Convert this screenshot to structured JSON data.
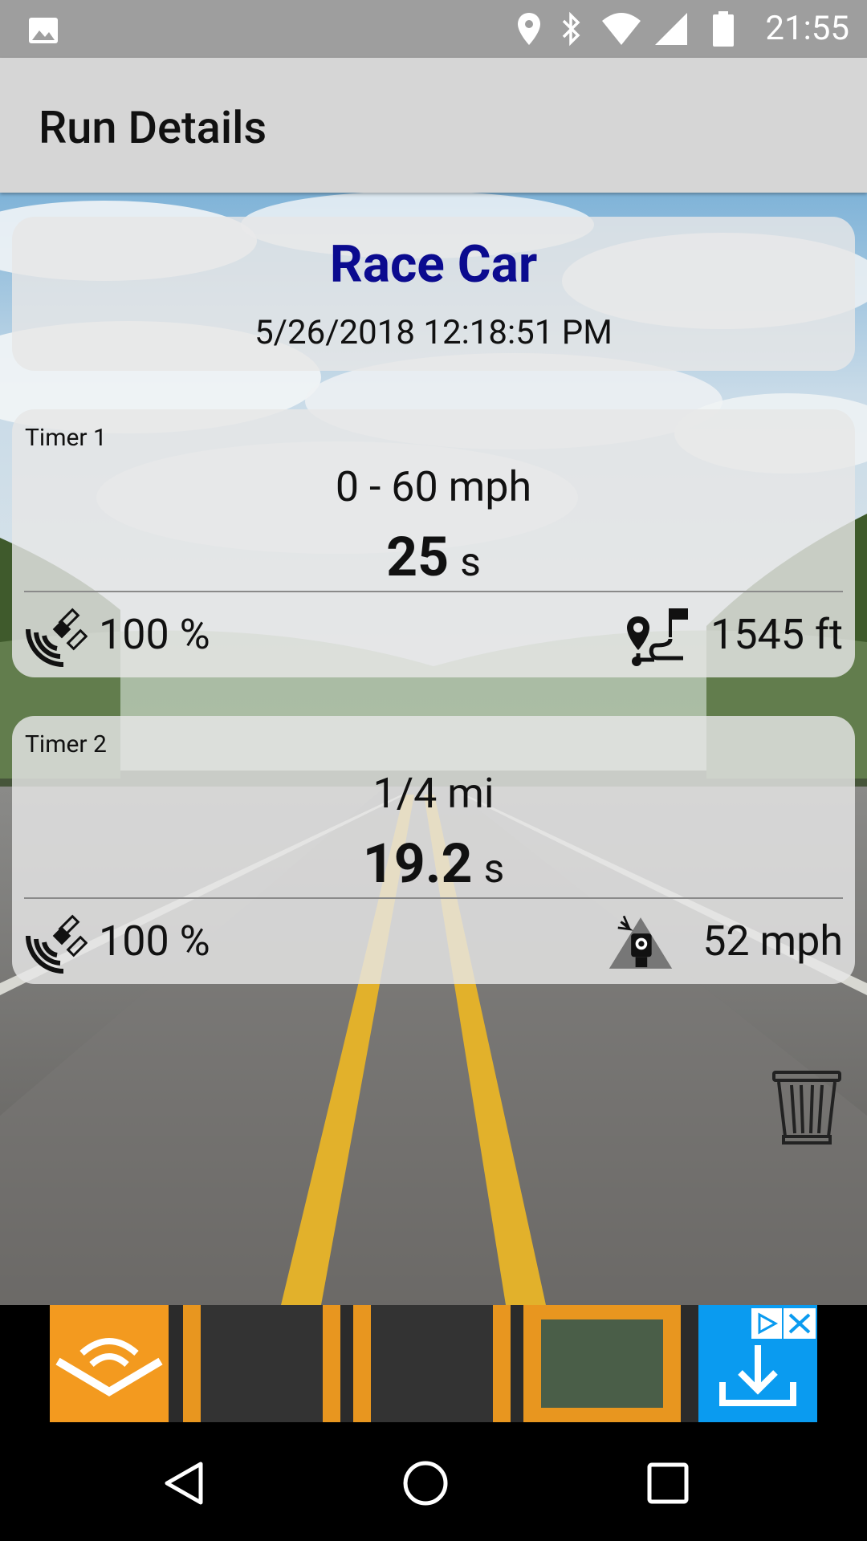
{
  "status_bar": {
    "time": "21:55",
    "icons": [
      "image-icon",
      "location-icon",
      "bluetooth-icon",
      "wifi-icon",
      "signal-icon",
      "battery-icon"
    ]
  },
  "app_bar": {
    "title": "Run Details"
  },
  "run": {
    "name": "Race Car",
    "datetime": "5/26/2018 12:18:51 PM",
    "name_color": "#0b0b8f"
  },
  "timers": [
    {
      "label": "Timer 1",
      "range": "0  -  60 mph",
      "result_value": "25",
      "result_unit": "s",
      "gps_accuracy": "100 %",
      "right_value": "1545 ft",
      "right_icon": "distance-route-icon"
    },
    {
      "label": "Timer 2",
      "range": "1/4 mi",
      "result_value": "19.2",
      "result_unit": "s",
      "gps_accuracy": "100 %",
      "right_value": "52 mph",
      "right_icon": "speed-camera-icon"
    }
  ],
  "actions": {
    "delete_icon": "trash-icon"
  },
  "ad": {
    "brand_color": "#f39a1f",
    "cta_color": "#0a9bf0"
  },
  "nav_bar": {
    "buttons": [
      "back-icon",
      "home-icon",
      "recents-icon"
    ]
  }
}
